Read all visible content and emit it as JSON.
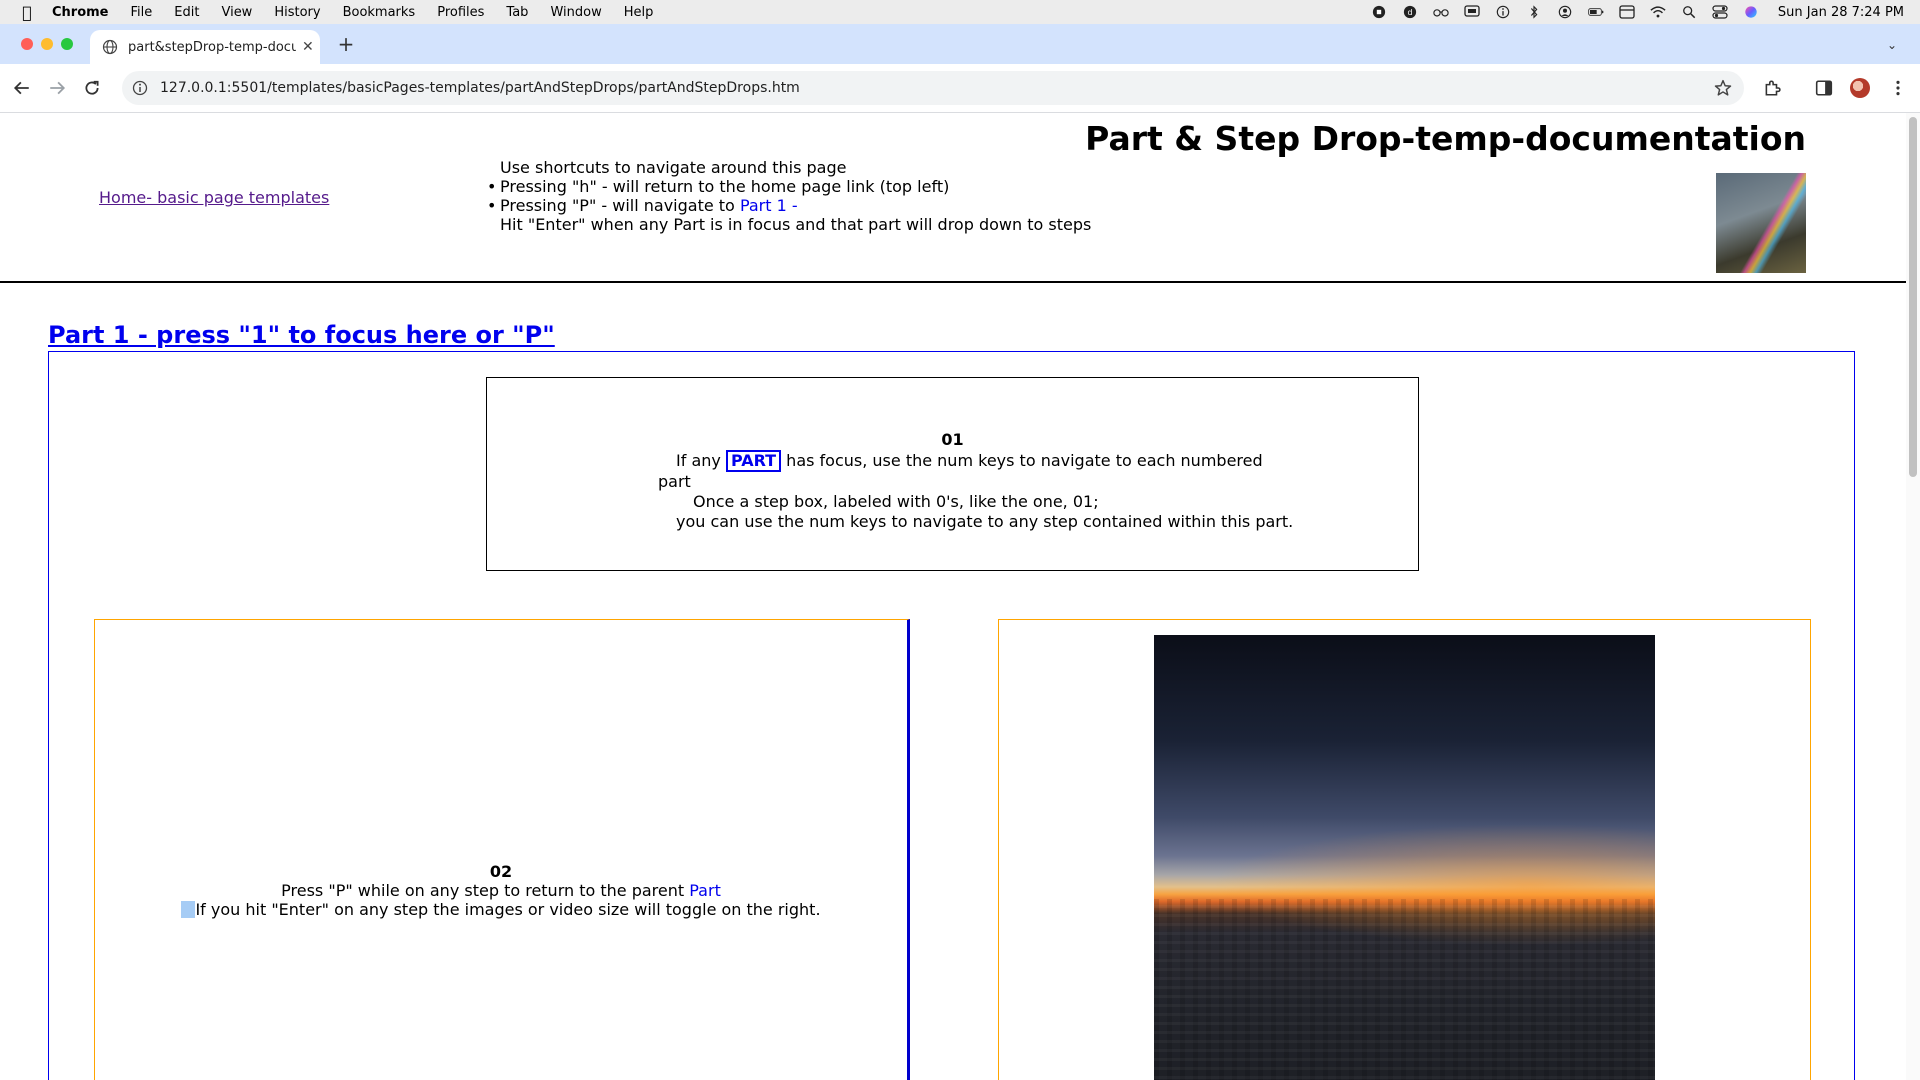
{
  "menubar": {
    "app_name": "Chrome",
    "items": [
      "File",
      "Edit",
      "View",
      "History",
      "Bookmarks",
      "Profiles",
      "Tab",
      "Window",
      "Help"
    ],
    "clock": "Sun Jan 28  7:24 PM"
  },
  "tab": {
    "title": "part&stepDrop-temp-docum"
  },
  "toolbar": {
    "url": "127.0.0.1:5501/templates/basicPages-templates/partAndStepDrops/partAndStepDrops.htm"
  },
  "page": {
    "home_link": "Home- basic page templates",
    "title": "Part & Step Drop-temp-documentation",
    "shortcuts": {
      "intro": "Use shortcuts to navigate around this page",
      "item1": "Pressing \"h\" - will return to the home page link (top left)",
      "item2_prefix": "Pressing \"P\" - will navigate to ",
      "item2_link": "Part 1 -",
      "enter_note": "Hit \"Enter\" when any Part is in focus and that part will drop down to steps"
    },
    "part": {
      "heading": "Part 1 - press \"1\" to focus here or \"P\"",
      "step1": {
        "number": "01",
        "line1_prefix": "If any ",
        "badge": "PART",
        "line1_suffix": " has focus, use the num keys to navigate to each numbered",
        "line2": "part",
        "line3": "Once a step box, labeled with 0's, like the one, 01;",
        "line4": "you can use the num keys to navigate to any step contained within this part."
      },
      "step2": {
        "number": "02",
        "line1_prefix": "Press \"P\" while on any step to return to the parent ",
        "line1_link": "Part",
        "line2": "If you hit \"Enter\" on any step the images or video size will toggle on the right."
      }
    }
  },
  "colors": {
    "link_blue": "#0000EE",
    "visited_purple": "#551A8B",
    "step_border_orange": "#FFA500"
  }
}
